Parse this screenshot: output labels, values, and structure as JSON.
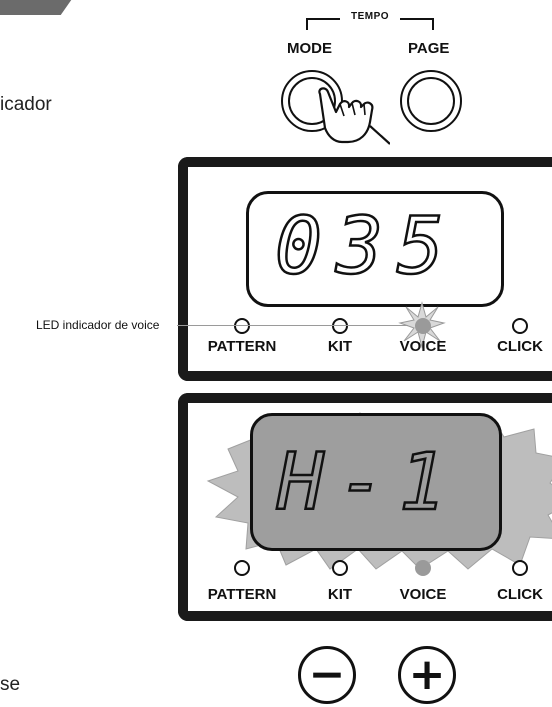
{
  "side_text_top": "icador",
  "side_text_bottom": "se",
  "tempo": {
    "label": "TEMPO",
    "mode_label": "MODE",
    "page_label": "PAGE"
  },
  "display_top": {
    "digits": "035",
    "callout": "LED indicador de voice",
    "leds": [
      {
        "label": "PATTERN",
        "on": false
      },
      {
        "label": "KIT",
        "on": false
      },
      {
        "label": "VOICE",
        "on": true
      },
      {
        "label": "CLICK",
        "on": false
      }
    ]
  },
  "display_bottom": {
    "digits": "H-1",
    "leds": [
      {
        "label": "PATTERN",
        "on": false
      },
      {
        "label": "KIT",
        "on": false
      },
      {
        "label": "VOICE",
        "on": true
      },
      {
        "label": "CLICK",
        "on": false
      }
    ]
  },
  "buttons": {
    "minus": "−",
    "plus": "+"
  },
  "colors": {
    "panel_border": "#1a1a1a",
    "led_on": "#9a9a9a",
    "flash": "#bdbdbd",
    "banner": "#6b6b6b"
  }
}
